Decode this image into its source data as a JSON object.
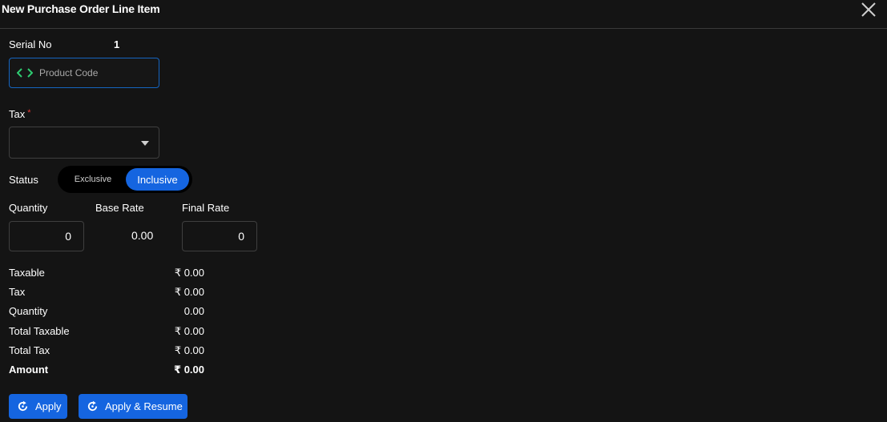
{
  "dialog": {
    "title": "New Purchase Order Line Item"
  },
  "form": {
    "serial_label": "Serial No",
    "serial_value": "1",
    "product_placeholder": "Product Code",
    "tax_label": "Tax",
    "tax_required_mark": "*",
    "tax_value": "",
    "status_label": "Status",
    "status_options": [
      "Exclusive",
      "Inclusive"
    ],
    "status_selected": "Inclusive",
    "quantity_label": "Quantity",
    "quantity_value": "0",
    "base_rate_label": "Base Rate",
    "base_rate_value": "0.00",
    "final_rate_label": "Final Rate",
    "final_rate_value": "0"
  },
  "summary": {
    "rows": [
      {
        "label": "Taxable",
        "value": "₹ 0.00"
      },
      {
        "label": "Tax",
        "value": "₹ 0.00"
      },
      {
        "label": "Quantity",
        "value": "0.00"
      },
      {
        "label": "Total Taxable",
        "value": "₹ 0.00"
      },
      {
        "label": "Total Tax",
        "value": "₹ 0.00"
      },
      {
        "label": "Amount",
        "value": "₹ 0.00"
      }
    ]
  },
  "actions": {
    "apply_label": "Apply",
    "apply_resume_label": "Apply & Resume"
  },
  "icons": {
    "close": "close-icon",
    "product_code": "code-brackets-icon",
    "dropdown": "caret-down-icon",
    "apply": "refresh-icon"
  },
  "colors": {
    "accent": "#1565e0",
    "background": "#141414",
    "required": "#e53935",
    "code_icon": "#2ecc71"
  }
}
